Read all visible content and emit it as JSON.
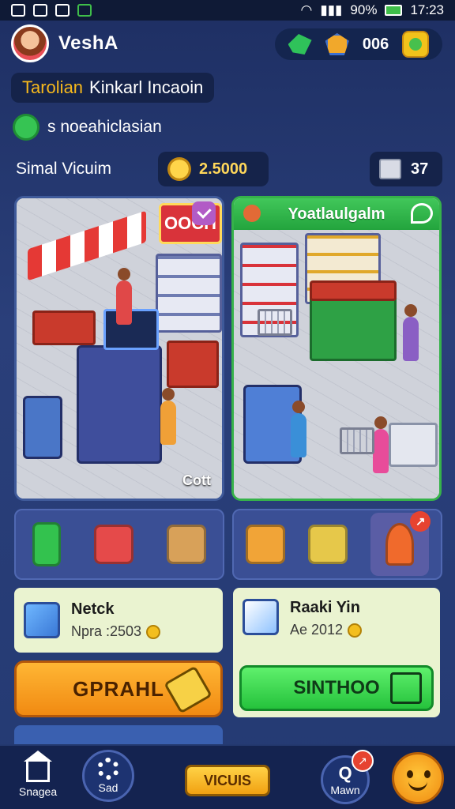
{
  "status_bar": {
    "battery": "90%",
    "time": "17:23"
  },
  "header": {
    "player_name": "VeshA",
    "resource_value": "006"
  },
  "banners": {
    "title_highlight": "Tarolian",
    "title_rest": "Kinkarl Incaoin",
    "subtitle": "s noeahiclasian"
  },
  "stats": {
    "label": "Simal Vicuim",
    "coins": "2.5000",
    "level": "37"
  },
  "scenes": {
    "left_sign": "OOCH",
    "left_corner": "Cott",
    "right_header": "Yoatlaulgalm"
  },
  "cards": {
    "left_title": "Netck",
    "left_sub": "Npra :2503",
    "right_title": "Raaki Yin",
    "right_sub": "Ae 2012"
  },
  "buttons": {
    "orange": "GPRAHL",
    "green": "SINTHOO"
  },
  "nav": {
    "home_label": "Snagea",
    "settings_label": "Sad",
    "center_label": "VICUIS",
    "q_label": "Mawn",
    "q_badge": "↗"
  },
  "colors": {
    "background": "#243a73",
    "accent_green": "#25c23c",
    "accent_orange": "#f18a12",
    "coin_gold": "#ffd75a"
  }
}
